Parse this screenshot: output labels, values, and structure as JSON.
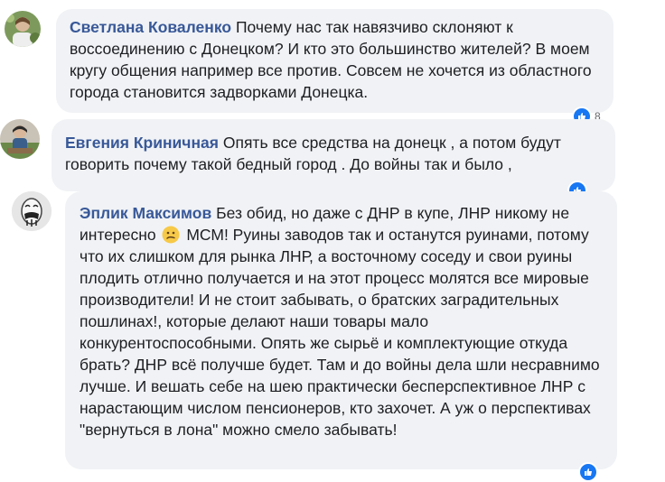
{
  "comments": [
    {
      "author": "Светлана Коваленко",
      "text": "Почему нас так навязчиво склоняют к воссоединению с Донецком? И кто это большинство жителей? В моем кругу общения например все против. Совсем не хочется из областного города становится задворками Донецка.",
      "reaction_count": "8"
    },
    {
      "author": "Евгения Криничная",
      "text": "Опять все средства на донецк , а потом будут говорить почему такой бедный город . До войны так и было ,",
      "reaction_count": ""
    },
    {
      "author": "Эплик Максимов",
      "text_part1": "Без обид, но даже с ДНР в купе, ЛНР никому не интересно",
      "text_part2": "МСМ! Руины заводов так и останутся руинами, потому что их слишком для рынка ЛНР, а восточному соседу и свои руины плодить отлично получается и на этот процесс молятся все мировые производители! И не стоит забывать, о братских заградительных пошлинах!, которые делают наши товары мало конкурентоспособными. Опять же сырьё и комплектующие откуда брать? ДНР всё получше будет. Там и до войны дела шли несравнимо лучше. И вешать себе на шею практически бесперспективное ЛНР с нарастающим числом пенсионеров, кто захочет. А уж о перспективах \"вернуться в лона\" можно смело забывать!",
      "emoji": "confused-face-icon"
    }
  ],
  "colors": {
    "author": "#385898",
    "bubble": "#f0f2f5",
    "like": "#1877f2"
  }
}
